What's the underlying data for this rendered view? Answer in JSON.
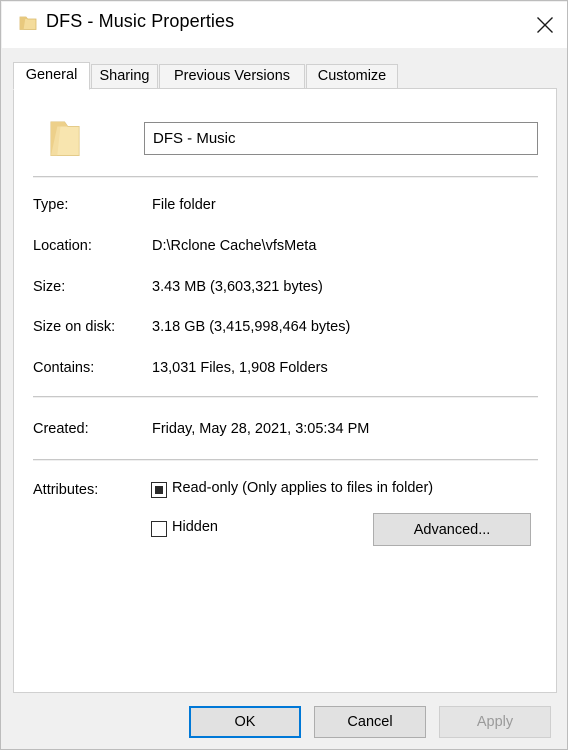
{
  "window": {
    "title": "DFS - Music Properties",
    "icon": "folder-icon",
    "close_label": "✕"
  },
  "tabs": [
    {
      "label": "General",
      "selected": true,
      "name": "tab-general"
    },
    {
      "label": "Sharing",
      "selected": false,
      "name": "tab-sharing"
    },
    {
      "label": "Previous Versions",
      "selected": false,
      "name": "tab-previous-versions"
    },
    {
      "label": "Customize",
      "selected": false,
      "name": "tab-customize"
    }
  ],
  "general": {
    "folder_icon": "folder-icon",
    "name_value": "DFS - Music",
    "name_placeholder": "",
    "rows": [
      {
        "label": "Type:",
        "value": "File folder"
      },
      {
        "label": "Location:",
        "value": "D:\\Rclone Cache\\vfsMeta"
      },
      {
        "label": "Size:",
        "value": "3.43 MB (3,603,321 bytes)"
      },
      {
        "label": "Size on disk:",
        "value": "3.18 GB (3,415,998,464 bytes)"
      },
      {
        "label": "Contains:",
        "value": "13,031 Files, 1,908 Folders"
      },
      {
        "label": "Created:",
        "value": "Friday, May 28, 2021, 3:05:34 PM"
      }
    ],
    "attributes": {
      "label": "Attributes:",
      "readonly": {
        "label": "Read-only (Only applies to files in folder)",
        "state": "indeterminate"
      },
      "hidden": {
        "label": "Hidden",
        "state": "unchecked"
      },
      "advanced_button": "Advanced..."
    }
  },
  "footer": {
    "ok": "OK",
    "cancel": "Cancel",
    "apply": "Apply",
    "apply_disabled": true
  },
  "colors": {
    "accent": "#0078d7",
    "dialog_bg": "#f0f0f0",
    "panel_bg": "#ffffff",
    "folder": "#f6dfa0",
    "disabled_text": "#9a9a9a"
  }
}
